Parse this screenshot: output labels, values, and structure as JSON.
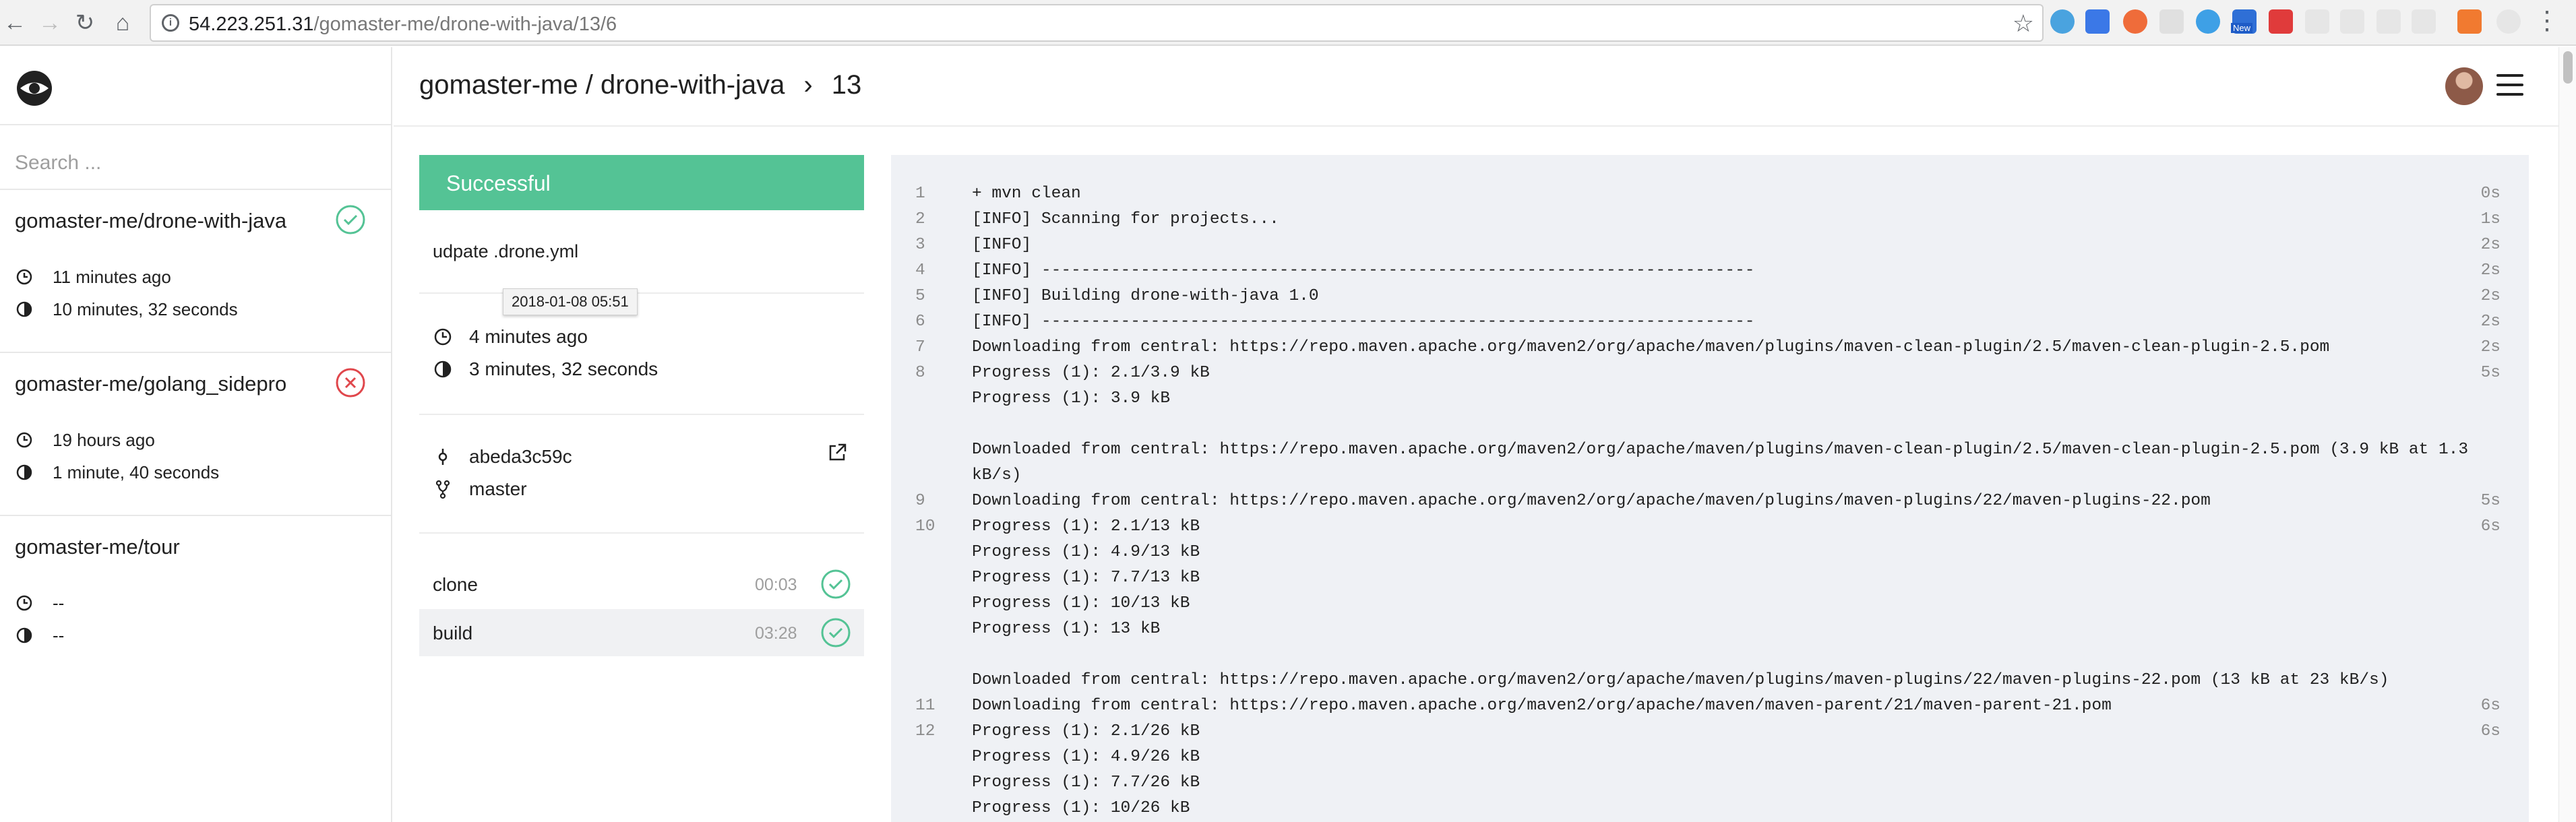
{
  "browser": {
    "url_host": "54.223.251.31",
    "url_path": "/gomaster-me/drone-with-java/13/6",
    "back_icon": "arrow-left-icon",
    "forward_icon": "arrow-right-icon",
    "reload_icon": "reload-icon",
    "home_icon": "home-icon",
    "bookmark_icon": "star-icon",
    "extension_new_badge": "New"
  },
  "sidebar": {
    "search_placeholder": "Search ...",
    "repos": [
      {
        "name": "gomaster-me/drone-with-java",
        "status": "success",
        "started": "11 minutes ago",
        "duration": "10 minutes, 32 seconds"
      },
      {
        "name": "gomaster-me/golang_sidepro",
        "status": "failure",
        "started": "19 hours ago",
        "duration": "1 minute, 40 seconds"
      },
      {
        "name": "gomaster-me/tour",
        "status": "none",
        "started": "--",
        "duration": "--"
      }
    ]
  },
  "header": {
    "repo": "gomaster-me / drone-with-java",
    "separator": "›",
    "build_number": "13"
  },
  "build": {
    "status_label": "Successful",
    "status_color": "#54c395",
    "message": "udpate .drone.yml",
    "tooltip": "2018-01-08 05:51",
    "started": "4 minutes ago",
    "duration": "3 minutes, 32 seconds",
    "commit": "abeda3c59c",
    "branch": "master",
    "steps": [
      {
        "name": "clone",
        "duration": "00:03",
        "active": false
      },
      {
        "name": "build",
        "duration": "03:28",
        "active": true
      }
    ]
  },
  "log": [
    {
      "n": "1",
      "text": "+ mvn clean",
      "t": "0s"
    },
    {
      "n": "2",
      "text": "[INFO] Scanning for projects...",
      "t": "1s"
    },
    {
      "n": "3",
      "text": "[INFO]",
      "t": "2s"
    },
    {
      "n": "4",
      "text": "[INFO] ------------------------------------------------------------------------",
      "t": "2s"
    },
    {
      "n": "5",
      "text": "[INFO] Building drone-with-java 1.0",
      "t": "2s"
    },
    {
      "n": "6",
      "text": "[INFO] ------------------------------------------------------------------------",
      "t": "2s"
    },
    {
      "n": "7",
      "text": "Downloading from central: https://repo.maven.apache.org/maven2/org/apache/maven/plugins/maven-clean-plugin/2.5/maven-clean-plugin-2.5.pom",
      "t": "2s"
    },
    {
      "n": "8",
      "text": "Progress (1): 2.1/3.9 kB",
      "t": "5s"
    },
    {
      "n": "",
      "text": "Progress (1): 3.9 kB",
      "t": ""
    },
    {
      "n": "",
      "text": "",
      "t": ""
    },
    {
      "n": "",
      "text": "Downloaded from central: https://repo.maven.apache.org/maven2/org/apache/maven/plugins/maven-clean-plugin/2.5/maven-clean-plugin-2.5.pom (3.9 kB at 1.3",
      "t": ""
    },
    {
      "n": "",
      "text": "kB/s)",
      "t": ""
    },
    {
      "n": "9",
      "text": "Downloading from central: https://repo.maven.apache.org/maven2/org/apache/maven/plugins/maven-plugins/22/maven-plugins-22.pom",
      "t": "5s"
    },
    {
      "n": "10",
      "text": "Progress (1): 2.1/13 kB",
      "t": "6s"
    },
    {
      "n": "",
      "text": "Progress (1): 4.9/13 kB",
      "t": ""
    },
    {
      "n": "",
      "text": "Progress (1): 7.7/13 kB",
      "t": ""
    },
    {
      "n": "",
      "text": "Progress (1): 10/13 kB",
      "t": ""
    },
    {
      "n": "",
      "text": "Progress (1): 13 kB",
      "t": ""
    },
    {
      "n": "",
      "text": "",
      "t": ""
    },
    {
      "n": "",
      "text": "Downloaded from central: https://repo.maven.apache.org/maven2/org/apache/maven/plugins/maven-plugins/22/maven-plugins-22.pom (13 kB at 23 kB/s)",
      "t": ""
    },
    {
      "n": "11",
      "text": "Downloading from central: https://repo.maven.apache.org/maven2/org/apache/maven/maven-parent/21/maven-parent-21.pom",
      "t": "6s"
    },
    {
      "n": "12",
      "text": "Progress (1): 2.1/26 kB",
      "t": "6s"
    },
    {
      "n": "",
      "text": "Progress (1): 4.9/26 kB",
      "t": ""
    },
    {
      "n": "",
      "text": "Progress (1): 7.7/26 kB",
      "t": ""
    },
    {
      "n": "",
      "text": "Progress (1): 10/26 kB",
      "t": ""
    }
  ]
}
